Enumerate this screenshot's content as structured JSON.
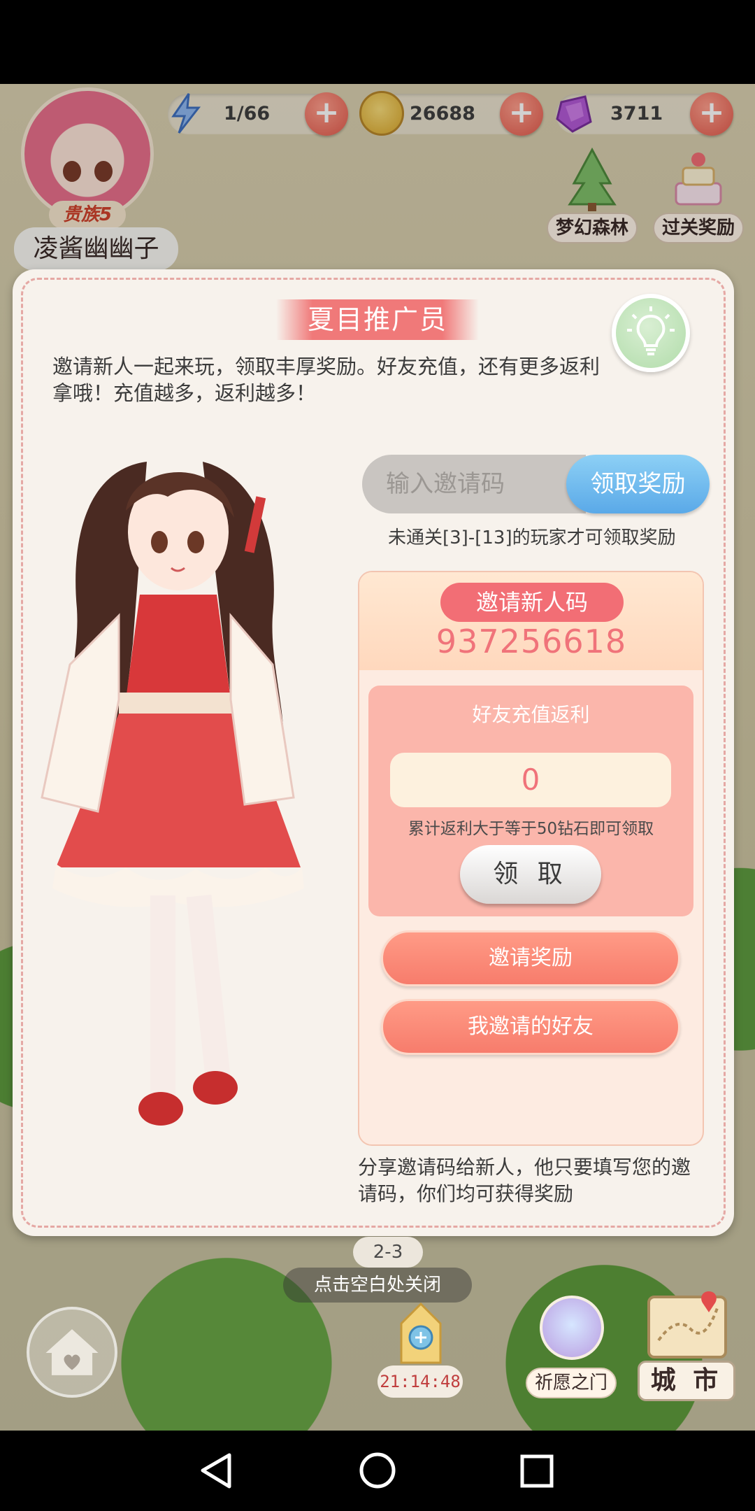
{
  "player": {
    "name": "凌酱幽幽子",
    "rank": "贵族5"
  },
  "resources": {
    "energy": "1/66",
    "gold": "26688",
    "diamonds": "3711"
  },
  "features": {
    "dream_forest": "梦幻森林",
    "level_reward": "过关奖励"
  },
  "dialog": {
    "title": "夏目推广员",
    "description": "邀请新人一起来玩，领取丰厚奖励。好友充值，还有更多返利拿哦！充值越多，返利越多！",
    "invite_input_placeholder": "输入邀请码",
    "claim_button": "领取奖励",
    "level_requirement": "未通关[3]-[13]的玩家才可领取奖励",
    "invite_code_label": "邀请新人码",
    "invite_code": "937256618",
    "rebate_title": "好友充值返利",
    "rebate_amount": "0",
    "rebate_note": "累计返利大于等于50钻石即可领取",
    "collect_button": "领 取",
    "invite_reward_button": "邀请奖励",
    "my_friends_button": "我邀请的好友",
    "share_note": "分享邀请码给新人，他只要填写您的邀请码，你们均可获得奖励"
  },
  "bottom": {
    "stage": "2-3",
    "close_hint": "点击空白处关闭",
    "timer": "21:14:48",
    "wish_door": "祈愿之门",
    "city": "城 市"
  },
  "colors": {
    "accent_pink": "#f26e75",
    "accent_blue": "#5aa9e8",
    "panel_bg": "#fdebe1"
  }
}
